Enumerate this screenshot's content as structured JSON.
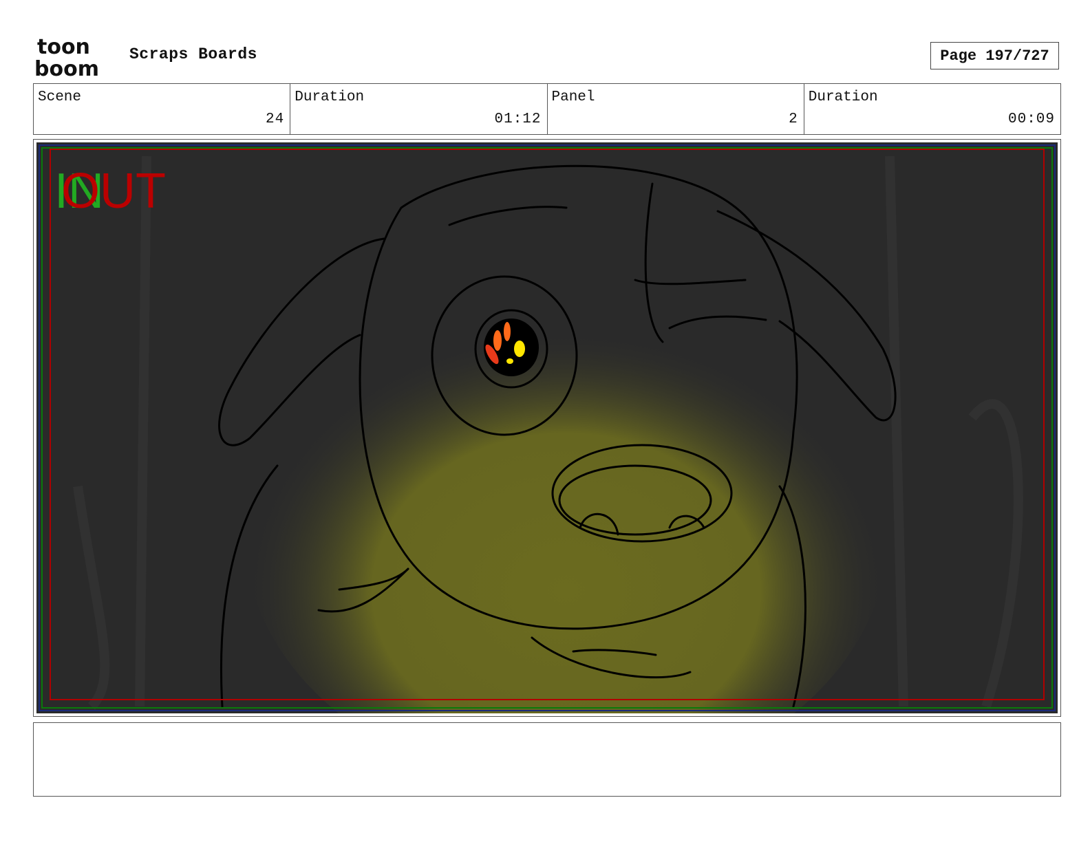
{
  "header": {
    "logo_text_top": "toon",
    "logo_text_bottom": "boom",
    "project_title": "Scraps Boards",
    "page_label": "Page 197/727"
  },
  "info": [
    {
      "label": "Scene",
      "value": "24"
    },
    {
      "label": "Duration",
      "value": "01:12"
    },
    {
      "label": "Panel",
      "value": "2"
    },
    {
      "label": "Duration",
      "value": "00:09"
    }
  ],
  "panel": {
    "in_marker": "IN",
    "out_marker": "OUT",
    "colors": {
      "background": "#2a2a2a",
      "glow": "#6b6b1f",
      "safe_red": "#b00000",
      "safe_green": "#0a7a0a",
      "safe_blue": "#1a2a7a",
      "in_green": "#22aa22",
      "out_red": "#bb0000",
      "eye_orange": "#ff6a1a",
      "eye_yellow": "#ffe600"
    }
  },
  "notes": {
    "text": ""
  }
}
